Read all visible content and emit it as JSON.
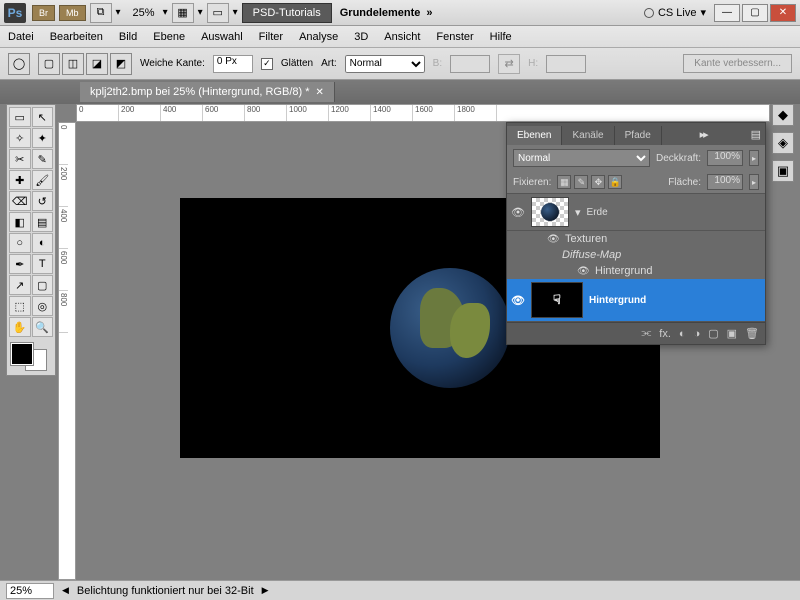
{
  "titlebar": {
    "logo": "Ps",
    "badge1": "Br",
    "badge2": "Mb",
    "zoom": "25%",
    "tutorials_btn": "PSD-Tutorials",
    "workspace": "Grundelemente",
    "cs_live": "CS Live"
  },
  "menubar": [
    "Datei",
    "Bearbeiten",
    "Bild",
    "Ebene",
    "Auswahl",
    "Filter",
    "Analyse",
    "3D",
    "Ansicht",
    "Fenster",
    "Hilfe"
  ],
  "options": {
    "feather_label": "Weiche Kante:",
    "feather_value": "0 Px",
    "antialias_label": "Glätten",
    "style_label": "Art:",
    "style_value": "Normal",
    "width_label": "B:",
    "height_label": "H:",
    "refine_btn": "Kante verbessern..."
  },
  "doctab": {
    "title": "kplj2th2.bmp bei 25% (Hintergrund, RGB/8) *"
  },
  "ruler_h": [
    "0",
    "200",
    "400",
    "600",
    "800",
    "1000",
    "1200",
    "1400",
    "1600",
    "1800"
  ],
  "ruler_v": [
    "0",
    "200",
    "400",
    "600",
    "800"
  ],
  "layers_panel": {
    "tabs": [
      "Ebenen",
      "Kanäle",
      "Pfade"
    ],
    "blend_mode": "Normal",
    "opacity_label": "Deckkraft:",
    "opacity_value": "100%",
    "lock_label": "Fixieren:",
    "fill_label": "Fläche:",
    "fill_value": "100%",
    "layer1_name": "Erde",
    "texturen_label": "Texturen",
    "diffuse_label": "Diffuse-Map",
    "hintergrund_sub": "Hintergrund",
    "layer2_name": "Hintergrund"
  },
  "statusbar": {
    "zoom": "25%",
    "message": "Belichtung funktioniert nur bei 32-Bit"
  }
}
